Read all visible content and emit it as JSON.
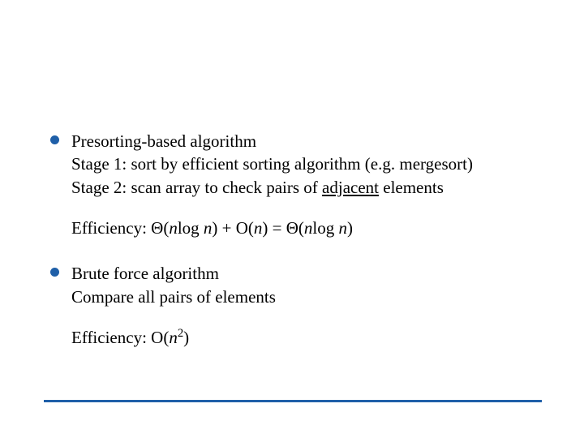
{
  "slide": {
    "bullets": [
      {
        "title": "Presorting-based algorithm",
        "lines": [
          {
            "text": "Stage 1: sort by efficient sorting algorithm (e.g. mergesort)"
          },
          {
            "prefix": "Stage 2: scan array to check pairs of ",
            "underlined": "adjacent",
            "suffix": " elements"
          }
        ],
        "efficiency": {
          "label": "Efficiency: ",
          "theta1": "Θ(",
          "n1": "n",
          "log1": "log ",
          "n2": "n",
          "close1": ") + O(",
          "n3": "n",
          "close2": ") = Θ(",
          "n4": "n",
          "log2": "log ",
          "n5": "n",
          "close3": ")"
        }
      },
      {
        "title": "Brute force algorithm",
        "lines": [
          {
            "text": "Compare all pairs of elements"
          }
        ],
        "efficiency": {
          "label": "Efficiency: O(",
          "n1": "n",
          "sup": "2",
          "close": ")"
        }
      }
    ]
  }
}
